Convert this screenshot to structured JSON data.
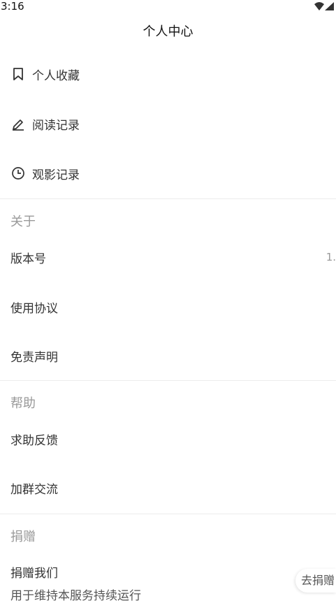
{
  "status_bar": {
    "time": "3:16",
    "icons": [
      "wifi-icon",
      "signal-icon"
    ]
  },
  "header": {
    "title": "个人中心"
  },
  "menu": {
    "favorites": {
      "label": "个人收藏",
      "icon": "bookmark-icon"
    },
    "reading_history": {
      "label": "阅读记录",
      "icon": "pencil-icon"
    },
    "watch_history": {
      "label": "观影记录",
      "icon": "clock-icon"
    }
  },
  "about": {
    "title": "关于",
    "version": {
      "label": "版本号",
      "value": "1."
    },
    "terms": {
      "label": "使用协议"
    },
    "disclaimer": {
      "label": "免责声明"
    }
  },
  "help": {
    "title": "帮助",
    "feedback": {
      "label": "求助反馈"
    },
    "group": {
      "label": "加群交流"
    }
  },
  "donate": {
    "title": "捐赠",
    "donate_us": {
      "label": "捐赠我们"
    },
    "description": "用于维持本服务持续运行",
    "fab_label": "去捐赠"
  }
}
